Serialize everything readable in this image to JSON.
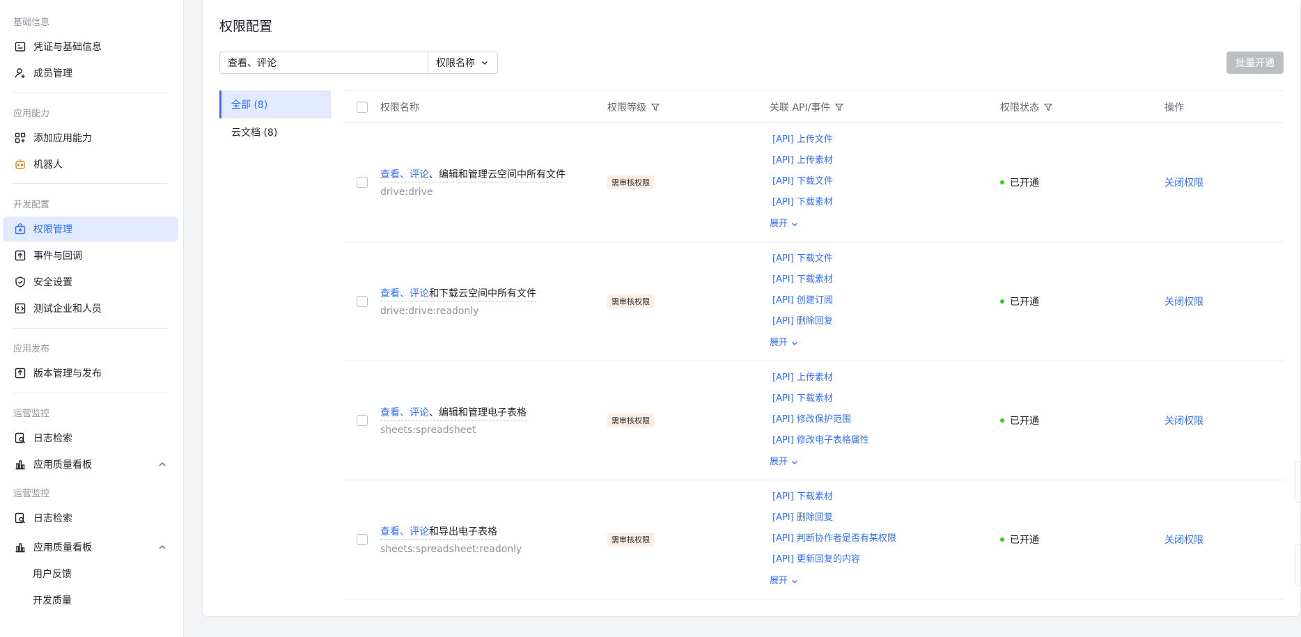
{
  "sidebar": {
    "sections": [
      {
        "title": "基础信息",
        "items": [
          {
            "label": "凭证与基础信息",
            "icon": "credential-icon"
          },
          {
            "label": "成员管理",
            "icon": "user-add-icon"
          }
        ]
      },
      {
        "title": "应用能力",
        "items": [
          {
            "label": "添加应用能力",
            "icon": "grid-add-icon"
          },
          {
            "label": "机器人",
            "icon": "robot-icon"
          }
        ]
      },
      {
        "title": "开发配置",
        "items": [
          {
            "label": "权限管理",
            "icon": "permission-icon",
            "active": true
          },
          {
            "label": "事件与回调",
            "icon": "event-icon"
          },
          {
            "label": "安全设置",
            "icon": "shield-icon"
          },
          {
            "label": "测试企业和人员",
            "icon": "code-icon"
          }
        ]
      },
      {
        "title": "应用发布",
        "items": [
          {
            "label": "版本管理与发布",
            "icon": "upload-icon"
          }
        ]
      },
      {
        "title": "运营监控",
        "items": [
          {
            "label": "日志检索",
            "icon": "log-search-icon"
          },
          {
            "label": "应用质量看板",
            "icon": "bar-chart-icon"
          }
        ]
      },
      {
        "title": "运营监控",
        "items": [
          {
            "label": "日志检索",
            "icon": "log-search-icon"
          },
          {
            "label": "应用质量看板",
            "icon": "bar-chart-icon"
          },
          {
            "label": "用户反馈"
          },
          {
            "label": "开发质量"
          }
        ]
      }
    ]
  },
  "main": {
    "title": "权限配置",
    "search": {
      "value": "查看、评论",
      "type_label": "权限名称"
    },
    "batch_button": "批量开通",
    "categories": [
      {
        "label": "全部 (8)"
      },
      {
        "label": "云文档 (8)"
      }
    ],
    "table": {
      "headers": {
        "name": "权限名称",
        "level": "权限等级",
        "api": "关联 API/事件",
        "status": "权限状态",
        "op": "操作"
      },
      "expand_label": "展开",
      "rows": [
        {
          "name_hl": "查看、评论",
          "name_rest": "、编辑和管理云空间中所有文件",
          "scope": "drive:drive",
          "level": "需审核权限",
          "apis": [
            "[API] 上传文件",
            "[API] 上传素材",
            "[API] 下载文件",
            "[API] 下载素材"
          ],
          "status": "已开通",
          "op": "关闭权限"
        },
        {
          "name_hl": "查看、评论",
          "name_rest": "和下载云空间中所有文件",
          "scope": "drive:drive:readonly",
          "level": "需审核权限",
          "apis": [
            "[API] 下载文件",
            "[API] 下载素材",
            "[API] 创建订阅",
            "[API] 删除回复"
          ],
          "status": "已开通",
          "op": "关闭权限"
        },
        {
          "name_hl": "查看、评论",
          "name_rest": "、编辑和管理电子表格",
          "scope": "sheets:spreadsheet",
          "level": "需审核权限",
          "apis": [
            "[API] 上传素材",
            "[API] 下载素材",
            "[API] 修改保护范围",
            "[API] 修改电子表格属性"
          ],
          "status": "已开通",
          "op": "关闭权限"
        },
        {
          "name_hl": "查看、评论",
          "name_rest": "和导出电子表格",
          "scope": "sheets:spreadsheet:readonly",
          "level": "需审核权限",
          "apis": [
            "[API] 下载素材",
            "[API] 删除回复",
            "[API] 判断协作者是否有某权限",
            "[API] 更新回复的内容"
          ],
          "status": "已开通",
          "op": "关闭权限"
        }
      ]
    }
  }
}
